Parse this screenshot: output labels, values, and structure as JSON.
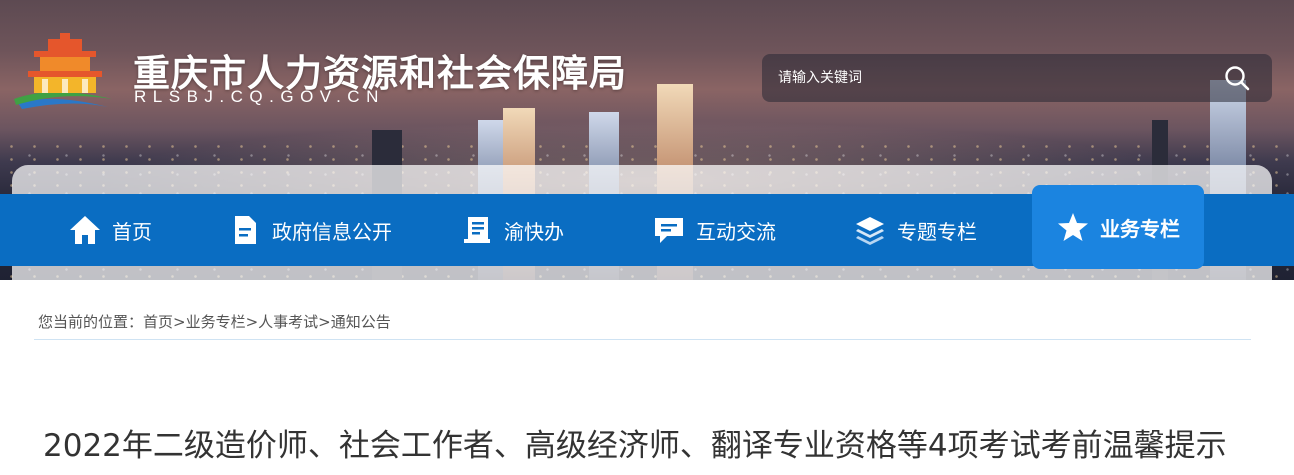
{
  "header": {
    "site_title": "重庆市人力资源和社会保障局",
    "site_domain": "RLSBJ.CQ.GOV.CN",
    "logo_icon": "temple-emblem-icon"
  },
  "search": {
    "placeholder": "请输入关键词",
    "value": "",
    "icon": "search-icon"
  },
  "nav": {
    "items": [
      {
        "label": "首页",
        "icon": "home-icon"
      },
      {
        "label": "政府信息公开",
        "icon": "document-icon"
      },
      {
        "label": "渝快办",
        "icon": "book-icon"
      },
      {
        "label": "互动交流",
        "icon": "chat-icon"
      },
      {
        "label": "专题专栏",
        "icon": "layers-icon"
      },
      {
        "label": "业务专栏",
        "icon": "star-icon",
        "active": true
      }
    ],
    "bar_color": "#0a6dc2",
    "active_color": "#1b84e0"
  },
  "breadcrumb": {
    "text": "您当前的位置：首页>业务专栏>人事考试>通知公告"
  },
  "article": {
    "title": "2022年二级造价师、社会工作者、高级经济师、翻译专业资格等4项考试考前温馨提示"
  }
}
